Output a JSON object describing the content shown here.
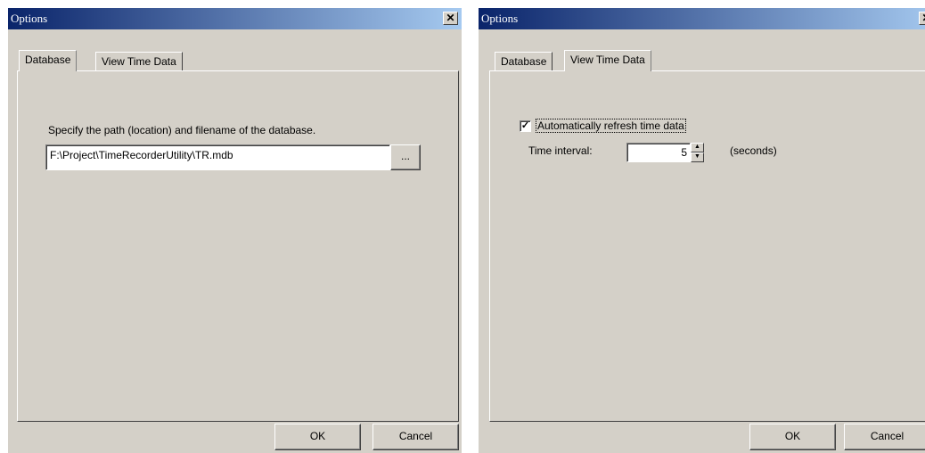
{
  "left_dialog": {
    "title": "Options",
    "close_glyph": "✕",
    "tabs": [
      {
        "label": "Database",
        "active": true
      },
      {
        "label": "View Time Data",
        "active": false
      }
    ],
    "database": {
      "description": "Specify the path (location) and filename of the database.",
      "path_value": "F:\\Project\\TimeRecorderUtility\\TR.mdb",
      "browse_label": "..."
    },
    "ok_label": "OK",
    "cancel_label": "Cancel"
  },
  "right_dialog": {
    "title": "Options",
    "close_glyph": "✕",
    "tabs": [
      {
        "label": "Database",
        "active": false
      },
      {
        "label": "View Time Data",
        "active": true
      }
    ],
    "view_time_data": {
      "auto_refresh_label": "Automatically refresh time data",
      "auto_refresh_checked": true,
      "check_glyph": "✓",
      "interval_label": "Time interval:",
      "interval_value": "5",
      "interval_unit": "(seconds)"
    },
    "ok_label": "OK",
    "cancel_label": "Cancel"
  },
  "icons": {
    "spin_up": "▲",
    "spin_down": "▼"
  }
}
